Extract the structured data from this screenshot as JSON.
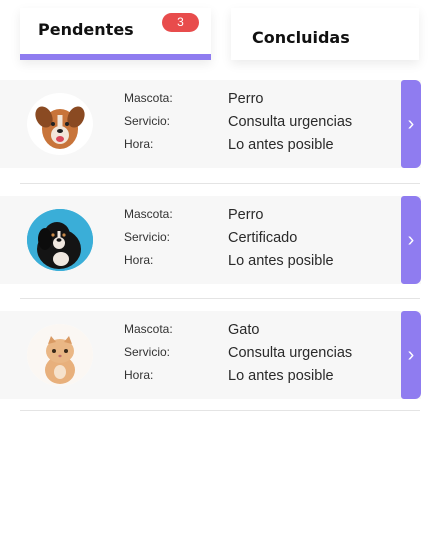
{
  "tabs": {
    "pending": {
      "label": "Pendentes",
      "count": "3"
    },
    "done": {
      "label": "Concluidas"
    }
  },
  "labels": {
    "pet": "Mascota:",
    "service": "Servicio:",
    "time": "Hora:"
  },
  "appointments": [
    {
      "pet": "Perro",
      "service": "Consulta urgencias",
      "time": "Lo antes posible",
      "avatar": "dog-photo"
    },
    {
      "pet": "Perro",
      "service": "Certificado",
      "time": "Lo antes posible",
      "avatar": "dog-photo"
    },
    {
      "pet": "Gato",
      "service": "Consulta urgencias",
      "time": "Lo antes posible",
      "avatar": "cat-photo"
    }
  ],
  "icons": {
    "open": "chevron-right-icon",
    "open_glyph": "›"
  },
  "colors": {
    "accent": "#8f7cf0",
    "badge": "#e84c4c"
  }
}
